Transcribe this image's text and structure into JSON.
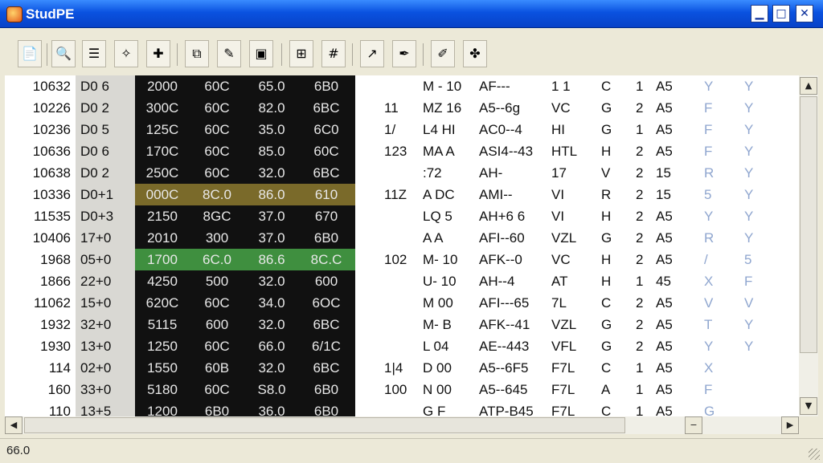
{
  "window": {
    "title": "StudPE",
    "min_glyph": "▁",
    "max_glyph": "□",
    "close_glyph": "✕"
  },
  "toolbar": {
    "icons": [
      "new-file-icon",
      "search-icon",
      "list-icon",
      "wand-icon",
      "plugin-icon",
      "copy-icon",
      "edit-icon",
      "image-icon",
      "compare-icon",
      "hex-icon",
      "chart-icon",
      "pen-icon",
      "brush-icon",
      "puzzle-icon"
    ]
  },
  "rows": [
    {
      "idx": "10632",
      "col2": "D0 6",
      "hex": [
        "2000",
        "60C",
        "65.0",
        "6B0"
      ],
      "f1": "",
      "f2": "M - 10",
      "f3": "AF---",
      "f4": "1 1",
      "f5": "C",
      "f6": "1",
      "f7": "A5",
      "y1": "Y",
      "y2": "Y"
    },
    {
      "idx": "10226",
      "col2": "D0 2",
      "hex": [
        "300C",
        "60C",
        "82.0",
        "6BC"
      ],
      "f1": "11",
      "f2": "MZ 16",
      "f3": "A5--6g",
      "f4": "VC",
      "f5": "G",
      "f6": "2",
      "f7": "A5",
      "y1": "F",
      "y2": "Y"
    },
    {
      "idx": "10236",
      "col2": "D0 5",
      "hex": [
        "125C",
        "60C",
        "35.0",
        "6C0"
      ],
      "f1": "1/",
      "f2": "L4 HI",
      "f3": "AC0--4",
      "f4": "HI",
      "f5": "G",
      "f6": "1",
      "f7": "A5",
      "y1": "F",
      "y2": "Y"
    },
    {
      "idx": "10636",
      "col2": "D0 6",
      "hex": [
        "170C",
        "60C",
        "85.0",
        "60C"
      ],
      "f1": "123",
      "f2": "MA A",
      "f3": "ASI4--43",
      "f4": "HTL",
      "f5": "H",
      "f6": "2",
      "f7": "A5",
      "y1": "F",
      "y2": "Y"
    },
    {
      "idx": "10638",
      "col2": "D0 2",
      "hex": [
        "250C",
        "60C",
        "32.0",
        "6BC"
      ],
      "f1": "",
      "f2": ":72",
      "f3": "AH-",
      "f4": "17",
      "f5": "V",
      "f6": "2",
      "f7": "15",
      "y1": "R",
      "y2": "Y"
    },
    {
      "idx": "10336",
      "col2": "D0+1",
      "hex": [
        "000C",
        "8C.0",
        "86.0",
        "610"
      ],
      "f1": "11Z",
      "f2": "A DC",
      "f3": "AMI--",
      "f4": "VI",
      "f5": "R",
      "f6": "2",
      "f7": "15",
      "y1": "5",
      "y2": "Y"
    },
    {
      "idx": "11535",
      "col2": "D0+3",
      "hex": [
        "2150",
        "8GC",
        "37.0",
        "670"
      ],
      "f1": "",
      "f2": "LQ 5",
      "f3": "AH+6 6",
      "f4": "VI",
      "f5": "H",
      "f6": "2",
      "f7": "A5",
      "y1": "Y",
      "y2": "Y"
    },
    {
      "idx": "10406",
      "col2": "17+0",
      "hex": [
        "2010",
        "300",
        "37.0",
        "6B0"
      ],
      "f1": "",
      "f2": "A A",
      "f3": "AFI--60",
      "f4": "VZL",
      "f5": "G",
      "f6": "2",
      "f7": "A5",
      "y1": "R",
      "y2": "Y"
    },
    {
      "idx": "1968",
      "col2": "05+0",
      "hex": [
        "1700",
        "6C.0",
        "86.6",
        "8C.C"
      ],
      "f1": "102",
      "f2": "M- 10",
      "f3": "AFK--0",
      "f4": "VC",
      "f5": "H",
      "f6": "2",
      "f7": "A5",
      "y1": "/",
      "y2": "5"
    },
    {
      "idx": "1866",
      "col2": "22+0",
      "hex": [
        "4250",
        "500",
        "32.0",
        "600"
      ],
      "f1": "",
      "f2": "U- 10",
      "f3": "AH--4",
      "f4": "AT",
      "f5": "H",
      "f6": "1",
      "f7": "45",
      "y1": "X",
      "y2": "F"
    },
    {
      "idx": "11062",
      "col2": "15+0",
      "hex": [
        "620C",
        "60C",
        "34.0",
        "6OC"
      ],
      "f1": "",
      "f2": "M 00",
      "f3": "AFI---65",
      "f4": "7L",
      "f5": "C",
      "f6": "2",
      "f7": "A5",
      "y1": "V",
      "y2": "V"
    },
    {
      "idx": "1932",
      "col2": "32+0",
      "hex": [
        "5115",
        "600",
        "32.0",
        "6BC"
      ],
      "f1": "",
      "f2": "M- B",
      "f3": "AFK--41",
      "f4": "VZL",
      "f5": "G",
      "f6": "2",
      "f7": "A5",
      "y1": "T",
      "y2": "Y"
    },
    {
      "idx": "1930",
      "col2": "13+0",
      "hex": [
        "1250",
        "60C",
        "66.0",
        "6/1C"
      ],
      "f1": "",
      "f2": "L 04",
      "f3": "AE--443",
      "f4": "VFL",
      "f5": "G",
      "f6": "2",
      "f7": "A5",
      "y1": "Y",
      "y2": "Y"
    },
    {
      "idx": "114",
      "col2": "02+0",
      "hex": [
        "1550",
        "60B",
        "32.0",
        "6BC"
      ],
      "f1": "1|4",
      "f2": "D 00",
      "f3": "A5--6F5",
      "f4": "F7L",
      "f5": "C",
      "f6": "1",
      "f7": "A5",
      "y1": "X",
      "y2": ""
    },
    {
      "idx": "160",
      "col2": "33+0",
      "hex": [
        "5180",
        "60C",
        "S8.0",
        "6B0"
      ],
      "f1": "100",
      "f2": "N 00",
      "f3": "A5--645",
      "f4": "F7L",
      "f5": "A",
      "f6": "1",
      "f7": "A5",
      "y1": "F",
      "y2": ""
    },
    {
      "idx": "110",
      "col2": "13+5",
      "hex": [
        "1200",
        "6B0",
        "36.0",
        "6B0"
      ],
      "f1": "",
      "f2": "G F",
      "f3": "ATP-B45",
      "f4": "F7L",
      "f5": "C",
      "f6": "1",
      "f7": "A5",
      "y1": "G",
      "y2": ""
    }
  ],
  "highlight": {
    "gold_row": 5,
    "green_row": 8,
    "gold_color": "#7a6a2a",
    "green_color": "#3f8f3f"
  },
  "scroll": {
    "up": "▲",
    "down": "▼",
    "left": "◀",
    "right": "▶"
  },
  "status": {
    "text": "66.0"
  }
}
